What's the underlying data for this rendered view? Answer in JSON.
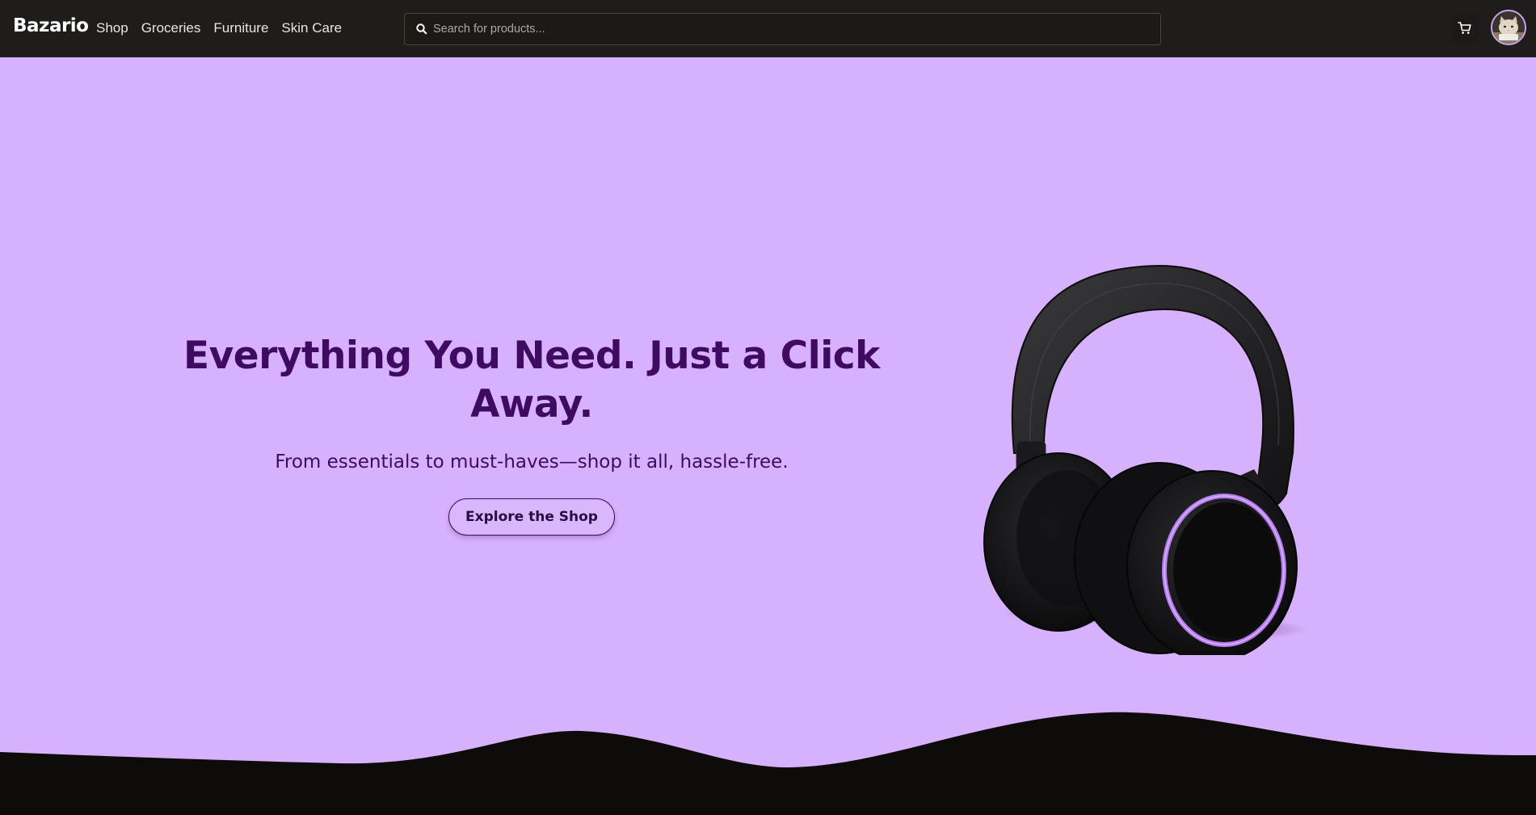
{
  "header": {
    "brand": "Bazario",
    "nav": [
      {
        "label": "Shop"
      },
      {
        "label": "Groceries"
      },
      {
        "label": "Furniture"
      },
      {
        "label": "Skin Care"
      }
    ],
    "search": {
      "placeholder": "Search for products...",
      "value": "",
      "icon": "search-icon"
    },
    "cart_icon": "cart-icon",
    "avatar_icon": "user-avatar"
  },
  "hero": {
    "title": "Everything You Need. Just a Click Away.",
    "subtitle": "From essentials to must-haves—shop it all, hassle-free.",
    "cta_label": "Explore the Shop",
    "image": "headphones-product-image"
  },
  "colors": {
    "navbar_bg": "#1f1c1a",
    "hero_bg": "#d8b1fd",
    "heading": "#3f0a61",
    "accent_glow": "#b77cf2",
    "footer_wave": "#0e0c0b"
  }
}
